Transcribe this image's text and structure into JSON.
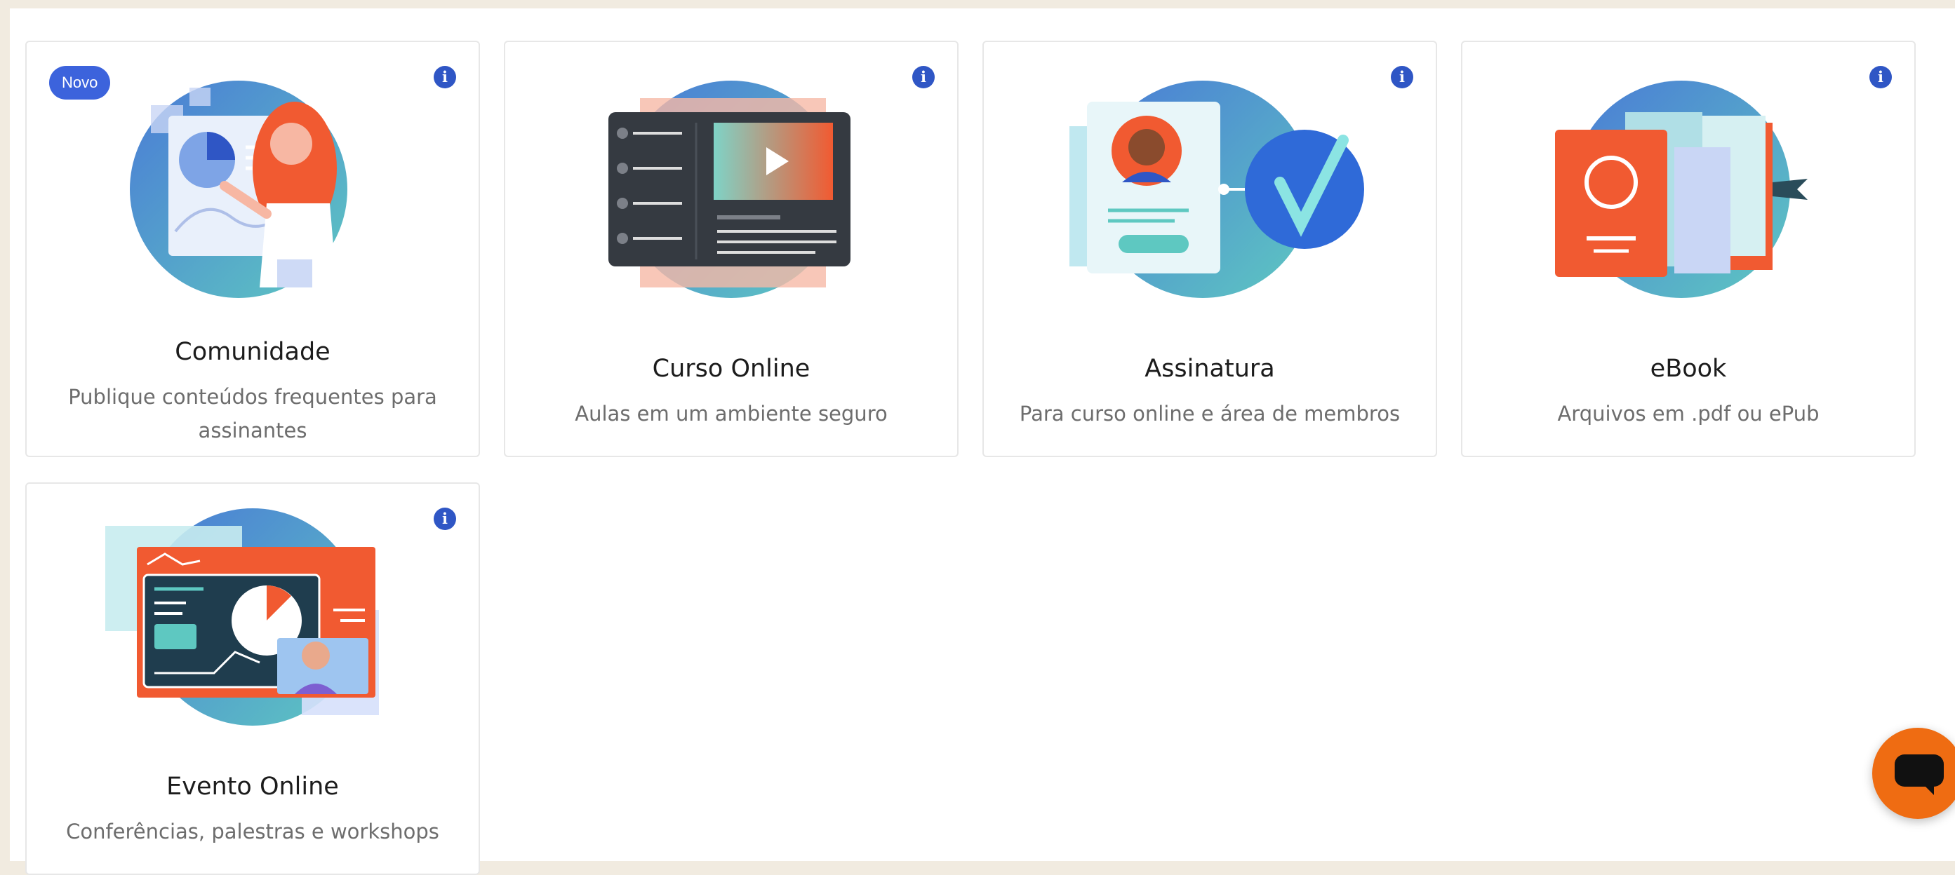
{
  "cards": [
    {
      "title": "Comunidade",
      "description": "Publique conteúdos frequentes para assinantes",
      "badge": "Novo",
      "info_icon": "info-icon"
    },
    {
      "title": "Curso Online",
      "description": "Aulas em um ambiente seguro",
      "info_icon": "info-icon"
    },
    {
      "title": "Assinatura",
      "description": "Para curso online e área de membros",
      "info_icon": "info-icon"
    },
    {
      "title": "eBook",
      "description": "Arquivos em .pdf ou ePub",
      "info_icon": "info-icon"
    },
    {
      "title": "Evento Online",
      "description": "Conferências, palestras e workshops",
      "info_icon": "info-icon"
    }
  ],
  "info_glyph": "i",
  "chat_button": {
    "icon": "chat-bubble-icon",
    "color": "#ef6c12"
  },
  "colors": {
    "accent_blue": "#2f56c5",
    "brand_orange": "#ef6c12"
  }
}
